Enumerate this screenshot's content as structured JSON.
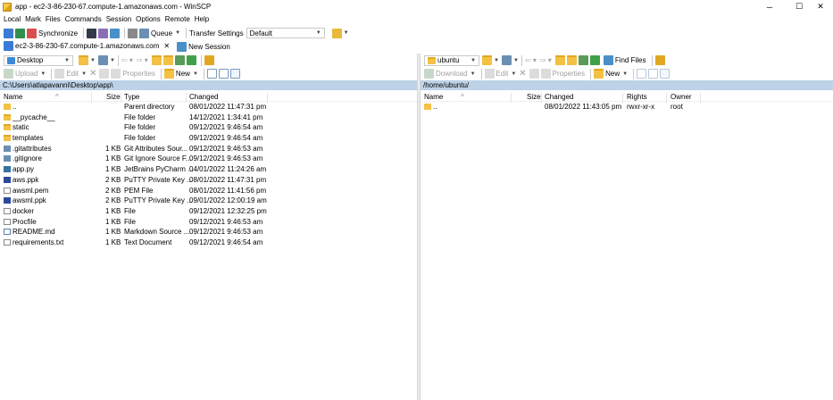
{
  "window": {
    "title": "app - ec2-3-86-230-67.compute-1.amazonaws.com - WinSCP",
    "controls": {
      "minimize": "─",
      "maximize": "☐",
      "close": "✕"
    }
  },
  "menu": [
    "Local",
    "Mark",
    "Files",
    "Commands",
    "Session",
    "Options",
    "Remote",
    "Help"
  ],
  "toolbar": {
    "synchronize": "Synchronize",
    "queue": "Queue",
    "transfer_settings": "Transfer Settings",
    "transfer_profile": "Default"
  },
  "tabs": [
    {
      "label": "ec2-3-86-230-67.compute-1.amazonaws.com",
      "close": "✕"
    },
    {
      "label": "New Session"
    }
  ],
  "left_panel": {
    "drive": "Desktop",
    "upload": "Upload",
    "edit": "Edit",
    "properties": "Properties",
    "new": "New",
    "path": "C:\\Users\\atlapavanni\\Desktop\\app\\",
    "columns": {
      "name": "Name",
      "size": "Size",
      "type": "Type",
      "changed": "Changed"
    },
    "files": [
      {
        "icon": "updir",
        "name": "..",
        "size": "",
        "type": "Parent directory",
        "changed": "08/01/2022  11:47:31 pm"
      },
      {
        "icon": "folder",
        "name": "__pycache__",
        "size": "",
        "type": "File folder",
        "changed": "14/12/2021  1:34:41 pm"
      },
      {
        "icon": "folder",
        "name": "static",
        "size": "",
        "type": "File folder",
        "changed": "09/12/2021  9:46:54 am"
      },
      {
        "icon": "folder",
        "name": "templates",
        "size": "",
        "type": "File folder",
        "changed": "09/12/2021  9:46:54 am"
      },
      {
        "icon": "gitfile",
        "name": ".gitattributes",
        "size": "1 KB",
        "type": "Git Attributes Sour...",
        "changed": "09/12/2021  9:46:53 am"
      },
      {
        "icon": "gitfile",
        "name": ".gitignore",
        "size": "1 KB",
        "type": "Git Ignore Source F...",
        "changed": "09/12/2021  9:46:53 am"
      },
      {
        "icon": "pyfile",
        "name": "app.py",
        "size": "1 KB",
        "type": "JetBrains PyCharm ...",
        "changed": "04/01/2022  11:24:26 am"
      },
      {
        "icon": "keyfile",
        "name": "aws.ppk",
        "size": "2 KB",
        "type": "PuTTY Private Key ...",
        "changed": "08/01/2022  11:47:31 pm"
      },
      {
        "icon": "file",
        "name": "awsml.pem",
        "size": "2 KB",
        "type": "PEM File",
        "changed": "08/01/2022  11:41:56 pm"
      },
      {
        "icon": "keyfile",
        "name": "awsml.ppk",
        "size": "2 KB",
        "type": "PuTTY Private Key ...",
        "changed": "09/01/2022  12:00:19 am"
      },
      {
        "icon": "file",
        "name": "docker",
        "size": "1 KB",
        "type": "File",
        "changed": "09/12/2021  12:32:25 pm"
      },
      {
        "icon": "file",
        "name": "Procfile",
        "size": "1 KB",
        "type": "File",
        "changed": "09/12/2021  9:46:53 am"
      },
      {
        "icon": "mdfile",
        "name": "README.md",
        "size": "1 KB",
        "type": "Markdown Source ...",
        "changed": "09/12/2021  9:46:53 am"
      },
      {
        "icon": "file",
        "name": "requirements.txt",
        "size": "1 KB",
        "type": "Text Document",
        "changed": "09/12/2021  9:46:54 am"
      }
    ]
  },
  "right_panel": {
    "drive": "ubuntu",
    "find_files": "Find Files",
    "download": "Download",
    "edit": "Edit",
    "properties": "Properties",
    "new": "New",
    "path": "/home/ubuntu/",
    "columns": {
      "name": "Name",
      "size": "Size",
      "changed": "Changed",
      "rights": "Rights",
      "owner": "Owner"
    },
    "files": [
      {
        "icon": "updir",
        "name": "..",
        "size": "",
        "changed": "08/01/2022 11:43:05 pm",
        "rights": "rwxr-xr-x",
        "owner": "root"
      }
    ]
  },
  "colors": {
    "path_bar": "#bdd2e6",
    "folder": "#f3c244",
    "accent": "#2c4a9a"
  }
}
